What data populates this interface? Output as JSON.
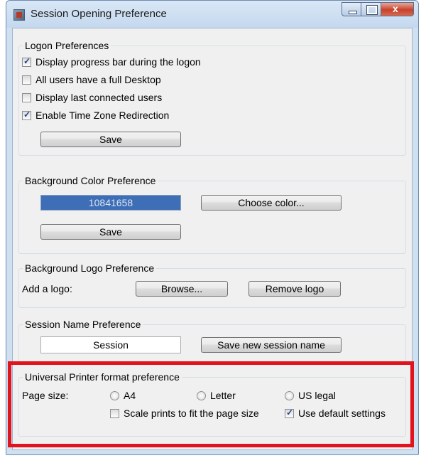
{
  "window": {
    "title": "Session Opening Preference",
    "close_glyph": "x"
  },
  "logon": {
    "legend": "Logon Preferences",
    "options": [
      {
        "label": "Display progress bar during the logon",
        "checked": true
      },
      {
        "label": "All users have a full Desktop",
        "checked": false
      },
      {
        "label": "Display last connected users",
        "checked": false
      },
      {
        "label": "Enable Time Zone Redirection",
        "checked": true
      }
    ],
    "save_label": "Save"
  },
  "background_color": {
    "legend": "Background Color Preference",
    "value": "10841658",
    "choose_label": "Choose color...",
    "save_label": "Save"
  },
  "background_logo": {
    "legend": "Background Logo Preference",
    "add_label": "Add a logo:",
    "browse_label": "Browse...",
    "remove_label": "Remove logo"
  },
  "session_name": {
    "legend": "Session Name Preference",
    "value": "Session",
    "save_label": "Save new session name"
  },
  "printer": {
    "legend": "Universal Printer format preference",
    "page_size_label": "Page size:",
    "sizes": [
      "A4",
      "Letter",
      "US legal"
    ],
    "scale_label": "Scale prints to fit the page size",
    "scale_checked": false,
    "default_label": "Use default settings",
    "default_checked": true
  },
  "colors": {
    "highlight": "#e1141e",
    "color_swatch": "#3e6eb5"
  }
}
